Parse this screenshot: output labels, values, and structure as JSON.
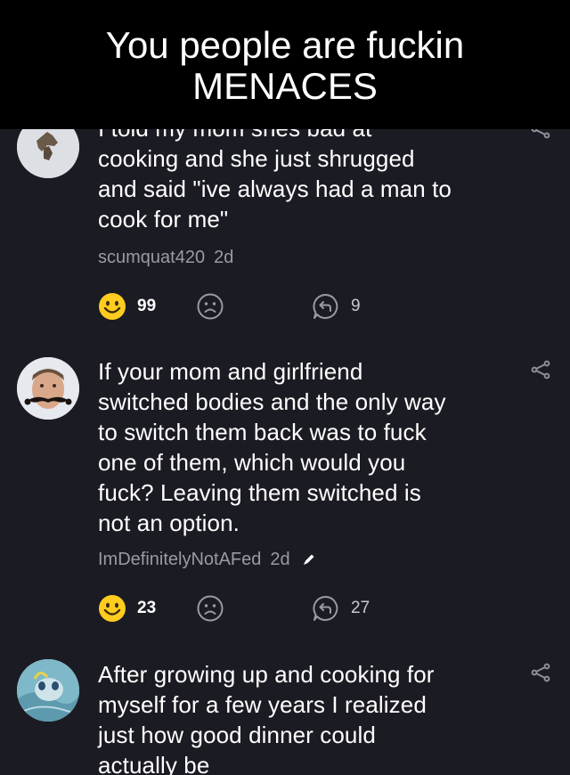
{
  "caption": {
    "line1": "You people are fuckin",
    "line2": "MENACES"
  },
  "comments": [
    {
      "partial_line": "I told my mom shes bad at",
      "lines": [
        "cooking and she just shrugged",
        "and said \"ive always had a man to",
        "cook for me\""
      ],
      "username": "scumquat420",
      "time": "2d",
      "likes": "99",
      "replies": "9",
      "avatar_icon": "bird-statue-avatar"
    },
    {
      "lines": [
        "If your mom and girlfriend",
        "switched bodies and the only way",
        "to switch them back was to fuck",
        "one of them, which would you",
        "fuck? Leaving them switched is",
        "not an option."
      ],
      "username": "ImDefinitelyNotAFed",
      "time": "2d",
      "likes": "23",
      "replies": "27",
      "avatar_icon": "mustache-man-avatar"
    },
    {
      "lines": [
        "After growing up and cooking for",
        "myself for a few years I realized",
        "just how good dinner could",
        "actually be"
      ],
      "avatar_icon": "blue-creature-avatar"
    }
  ],
  "colors": {
    "background": "#1b1b23",
    "caption_bg": "#000000",
    "emoji_yellow": "#ffcc1f",
    "meta_gray": "#9a9aa3"
  }
}
